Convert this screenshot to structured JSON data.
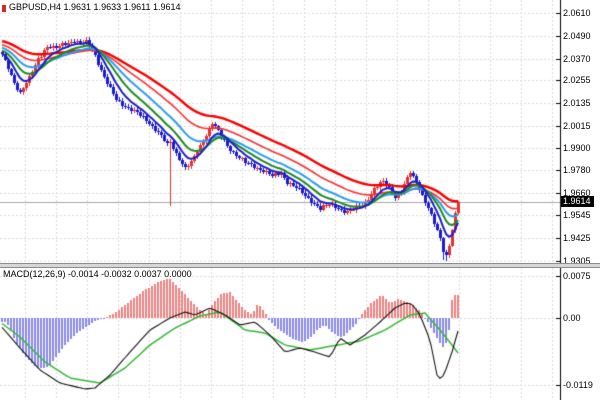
{
  "window": {
    "title_symbol": "GBPUSD,H4",
    "title_ohlc": "1.9631 1.9633 1.9611 1.9614"
  },
  "price_panel": {
    "current_price": "1.9614",
    "axis_labels": [
      "2.0610",
      "2.0490",
      "2.0370",
      "2.0255",
      "2.0135",
      "2.0015",
      "1.9900",
      "1.9780",
      "1.9660",
      "1.9545",
      "1.9425",
      "1.9305"
    ]
  },
  "macd_panel": {
    "label": "MACD(12,26,9)",
    "values": "-0.0014 -0.0032 0.0037 0.0000",
    "axis_labels": [
      "0.0075",
      "0.00",
      "-0.0119"
    ]
  },
  "colors": {
    "background": "#ffffff",
    "grid": "#dbdbdb",
    "axis_line": "#000000",
    "candle_up": "#e03232",
    "candle_down": "#1c1cce",
    "bid_line": "#a8a8a8",
    "price_tag_bg": "#000000",
    "price_tag_text": "#ffffff",
    "hist_positive": "#ef8282",
    "hist_negative": "#8a8aee",
    "macd_main": "#151515",
    "macd_signal": "#35b835"
  },
  "chart_data": [
    {
      "type": "candlestick",
      "title": "GBPUSD,H4 1.9631 1.9633 1.9611 1.9614",
      "symbol": "GBPUSD",
      "timeframe": "H4",
      "open": "1.9631",
      "high": "1.9633",
      "low": "1.9611",
      "close_last": "1.9614",
      "current_price": 1.9614,
      "ylim": [
        1.9305,
        2.061
      ],
      "y_ticks": [
        2.061,
        2.049,
        2.037,
        2.0255,
        2.0135,
        2.0015,
        1.99,
        1.978,
        1.966,
        1.9545,
        1.9425,
        1.9305
      ],
      "candle_count": 153,
      "close_waypoints": [
        [
          0,
          2.039
        ],
        [
          2,
          2.032
        ],
        [
          4,
          2.0245
        ],
        [
          6,
          2.019
        ],
        [
          9,
          2.0265
        ],
        [
          12,
          2.037
        ],
        [
          15,
          2.0435
        ],
        [
          18,
          2.0425
        ],
        [
          21,
          2.045
        ],
        [
          24,
          2.0465
        ],
        [
          26,
          2.0445
        ],
        [
          28,
          2.0455
        ],
        [
          30,
          2.042
        ],
        [
          32,
          2.035
        ],
        [
          34,
          2.027
        ],
        [
          36,
          2.021
        ],
        [
          38,
          2.0155
        ],
        [
          40,
          2.013
        ],
        [
          43,
          2.01
        ],
        [
          46,
          2.007
        ],
        [
          49,
          2.003
        ],
        [
          52,
          1.998
        ],
        [
          55,
          1.9915
        ],
        [
          56,
          1.993
        ],
        [
          58,
          1.987
        ],
        [
          61,
          1.979
        ],
        [
          63,
          1.982
        ],
        [
          65,
          1.988
        ],
        [
          67,
          1.994
        ],
        [
          69,
          2.0
        ],
        [
          70,
          2.003
        ],
        [
          71,
          2.001
        ],
        [
          73,
          1.996
        ],
        [
          75,
          1.991
        ],
        [
          78,
          1.986
        ],
        [
          81,
          1.982
        ],
        [
          84,
          1.98
        ],
        [
          87,
          1.978
        ],
        [
          90,
          1.975
        ],
        [
          93,
          1.9765
        ],
        [
          95,
          1.972
        ],
        [
          98,
          1.969
        ],
        [
          100,
          1.966
        ],
        [
          103,
          1.962
        ],
        [
          106,
          1.958
        ],
        [
          109,
          1.96
        ],
        [
          112,
          1.958
        ],
        [
          115,
          1.956
        ],
        [
          118,
          1.958
        ],
        [
          121,
          1.961
        ],
        [
          124,
          1.968
        ],
        [
          127,
          1.972
        ],
        [
          129,
          1.969
        ],
        [
          131,
          1.964
        ],
        [
          133,
          1.967
        ],
        [
          136,
          1.977
        ],
        [
          138,
          1.972
        ],
        [
          140,
          1.965
        ],
        [
          142,
          1.958
        ],
        [
          144,
          1.95
        ],
        [
          146,
          1.942
        ],
        [
          147,
          1.936
        ],
        [
          148,
          1.933
        ],
        [
          149,
          1.939
        ],
        [
          150,
          1.947
        ],
        [
          151,
          1.955
        ],
        [
          152,
          1.9614
        ]
      ],
      "candle_overrides": {
        "56": {
          "low": 1.959,
          "close": 1.993
        },
        "147": {
          "low": 1.931
        },
        "148": {
          "low": 1.9305
        },
        "152": {
          "close": 1.9614
        }
      },
      "moving_averages": [
        {
          "name": "ema-slowest",
          "period": 50,
          "color": "#f80000",
          "width": 2.4,
          "seed_offset": 0.007
        },
        {
          "name": "ema-slow",
          "period": 34,
          "color": "#f83030",
          "width": 1.6,
          "seed_offset": 0.005
        },
        {
          "name": "ema-medium",
          "period": 21,
          "color": "#2e9cf0",
          "width": 2.0,
          "seed_offset": 0.0035
        },
        {
          "name": "ema-fast",
          "period": 13,
          "color": "#1f8a1f",
          "width": 2.0,
          "seed_offset": 0.002
        },
        {
          "name": "ema-fastest",
          "period": 7,
          "color": "#1f1fc8",
          "width": 2.0,
          "seed_offset": 0.0
        }
      ]
    },
    {
      "type": "macd",
      "title": "MACD(12,26,9) -0.0014 -0.0032 0.0037 0.0000",
      "params": [
        12,
        26,
        9
      ],
      "ylim": [
        -0.0119,
        0.0075
      ],
      "y_ticks": [
        0.0075,
        0.0,
        -0.0119
      ],
      "main_line_points": [
        [
          0,
          -0.00125
        ],
        [
          20,
          -0.00536
        ],
        [
          40,
          -0.00929
        ],
        [
          60,
          -0.01161
        ],
        [
          85,
          -0.01268
        ],
        [
          95,
          -0.0125
        ],
        [
          110,
          -0.01018
        ],
        [
          130,
          -0.00607
        ],
        [
          150,
          -0.00214
        ],
        [
          170,
          0.0
        ],
        [
          185,
          0.00107
        ],
        [
          195,
          0.00054
        ],
        [
          210,
          0.00179
        ],
        [
          225,
          0.00054
        ],
        [
          240,
          -0.00125
        ],
        [
          255,
          -0.00071
        ],
        [
          270,
          -0.00304
        ],
        [
          285,
          -0.00607
        ],
        [
          300,
          -0.00536
        ],
        [
          315,
          -0.00607
        ],
        [
          330,
          -0.00696
        ],
        [
          340,
          -0.00357
        ],
        [
          350,
          -0.00482
        ],
        [
          365,
          -0.00304
        ],
        [
          380,
          -0.00071
        ],
        [
          395,
          0.00179
        ],
        [
          405,
          0.00268
        ],
        [
          412,
          0.0025
        ],
        [
          420,
          0.00054
        ],
        [
          430,
          -0.00393
        ],
        [
          438,
          -0.01107
        ],
        [
          444,
          -0.01018
        ],
        [
          452,
          -0.00607
        ],
        [
          458,
          -0.00232
        ]
      ],
      "signal_line_points": [
        [
          0,
          -0.00071
        ],
        [
          20,
          -0.00339
        ],
        [
          45,
          -0.00786
        ],
        [
          70,
          -0.01071
        ],
        [
          100,
          -0.01161
        ],
        [
          125,
          -0.00893
        ],
        [
          150,
          -0.00482
        ],
        [
          175,
          -0.00179
        ],
        [
          200,
          0.00036
        ],
        [
          220,
          0.00107
        ],
        [
          245,
          -0.00214
        ],
        [
          265,
          -0.00268
        ],
        [
          285,
          -0.00482
        ],
        [
          310,
          -0.00571
        ],
        [
          335,
          -0.00491
        ],
        [
          360,
          -0.00411
        ],
        [
          385,
          -0.00214
        ],
        [
          410,
          0.00054
        ],
        [
          425,
          0.00089
        ],
        [
          440,
          -0.00214
        ],
        [
          452,
          -0.00482
        ],
        [
          458,
          -0.00625
        ]
      ],
      "histogram_points": [
        [
          7,
          -0.0008
        ],
        [
          15,
          -0.004
        ],
        [
          25,
          -0.0068
        ],
        [
          38,
          -0.009
        ],
        [
          48,
          -0.0088
        ],
        [
          58,
          -0.0065
        ],
        [
          68,
          -0.0042
        ],
        [
          78,
          -0.0026
        ],
        [
          88,
          -0.0013
        ],
        [
          97,
          -0.0004
        ],
        [
          105,
          0.0
        ],
        [
          117,
          0.0012
        ],
        [
          130,
          0.003
        ],
        [
          145,
          0.005
        ],
        [
          162,
          0.0068
        ],
        [
          170,
          0.007
        ],
        [
          180,
          0.0052
        ],
        [
          190,
          0.0032
        ],
        [
          200,
          0.0015
        ],
        [
          206,
          0.0006
        ],
        [
          213,
          0.0026
        ],
        [
          222,
          0.0044
        ],
        [
          230,
          0.0046
        ],
        [
          238,
          0.0028
        ],
        [
          246,
          0.0013
        ],
        [
          252,
          0.0007
        ],
        [
          258,
          0.0026
        ],
        [
          264,
          0.0013
        ],
        [
          270,
          -0.0006
        ],
        [
          280,
          -0.0022
        ],
        [
          292,
          -0.0036
        ],
        [
          302,
          -0.0043
        ],
        [
          310,
          -0.0036
        ],
        [
          318,
          -0.002
        ],
        [
          325,
          -0.0012
        ],
        [
          334,
          -0.0028
        ],
        [
          342,
          -0.0035
        ],
        [
          350,
          -0.0022
        ],
        [
          357,
          -0.0008
        ],
        [
          363,
          0.001
        ],
        [
          372,
          0.0028
        ],
        [
          382,
          0.0041
        ],
        [
          390,
          0.0026
        ],
        [
          399,
          0.0034
        ],
        [
          406,
          0.003
        ],
        [
          414,
          0.0022
        ],
        [
          421,
          0.001
        ],
        [
          428,
          -0.0008
        ],
        [
          435,
          -0.003
        ],
        [
          443,
          -0.0052
        ],
        [
          448,
          -0.004
        ],
        [
          452,
          0.0032
        ],
        [
          456,
          0.0045
        ],
        [
          459,
          0.0038
        ]
      ]
    }
  ]
}
